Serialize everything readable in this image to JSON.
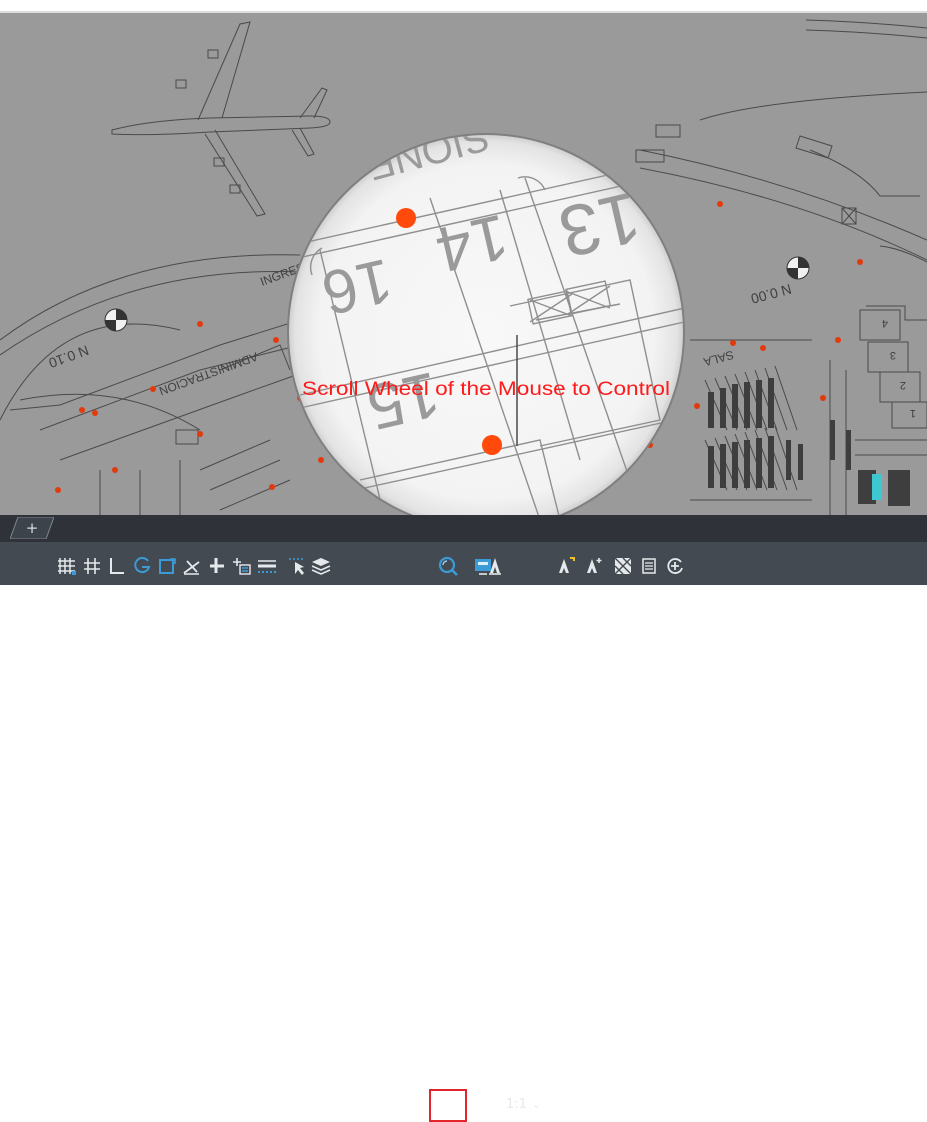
{
  "viewport": {
    "annotation": "Scroll Wheel of the Mouse to Control",
    "annotation_color": "#ff1a1a",
    "drawing_background": "#9a9a9a",
    "marker_color": "#e13a0c",
    "magnified_background": "#f7f7f7",
    "drawing_texts": {
      "bay_13": "13",
      "bay_14": "14",
      "bay_15": "15",
      "bay_16": "16",
      "sign_top": "SIONE",
      "entrance": "INGRESO DE",
      "administration": "ADMINISTRACION",
      "level_left": "N 0.10",
      "level_right": "N 0.00",
      "sala": "SALA",
      "rows": [
        "4",
        "3",
        "2",
        "1"
      ]
    }
  },
  "layout_tabs": {
    "add_label": "+"
  },
  "status_bar": {
    "buttons": [
      {
        "id": "model-space",
        "icon": "grid-display-icon"
      },
      {
        "id": "grid",
        "icon": "grid-icon"
      },
      {
        "id": "ortho",
        "icon": "ortho-icon"
      },
      {
        "id": "polar",
        "icon": "polar-tracking-icon"
      },
      {
        "id": "isodraft",
        "icon": "isodraft-icon"
      },
      {
        "id": "object-snap-tracking",
        "icon": "snap-tracking-icon"
      },
      {
        "id": "object-snap",
        "icon": "object-snap-icon"
      },
      {
        "id": "dynamic-ucs",
        "icon": "dynamic-ucs-icon"
      },
      {
        "id": "lineweight",
        "icon": "lineweight-icon"
      },
      {
        "id": "selection-cycling",
        "icon": "selection-cycling-icon"
      },
      {
        "id": "layers",
        "icon": "layers-icon"
      },
      {
        "id": "zoom",
        "icon": "zoom-magnifier-icon",
        "active": true
      },
      {
        "id": "viewport",
        "icon": "viewport-icon"
      },
      {
        "id": "annotation-scale",
        "icon": "annotation-scale-icon"
      },
      {
        "id": "annotation-visibility",
        "icon": "annotation-visibility-icon"
      },
      {
        "id": "auto-scale",
        "icon": "auto-scale-icon"
      },
      {
        "id": "isolate",
        "icon": "isolate-objects-icon"
      },
      {
        "id": "properties",
        "icon": "properties-icon"
      },
      {
        "id": "customize",
        "icon": "customize-icon"
      }
    ],
    "scale_value": "1:1",
    "scale_arrow": "⌄",
    "icon_color": "#e6e9ec",
    "accent": "#3c9bd7",
    "highlight_color": "#e0262a"
  }
}
